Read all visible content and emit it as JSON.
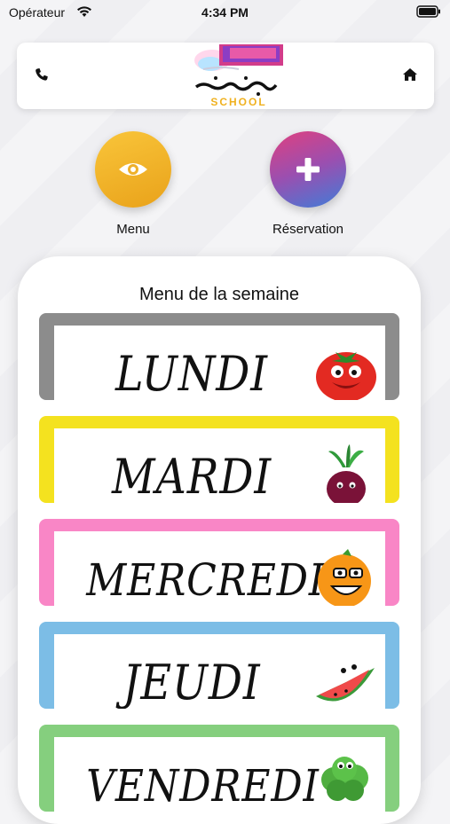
{
  "status_bar": {
    "carrier": "Opérateur",
    "time": "4:34 PM"
  },
  "header": {
    "logo_text": "SCHOOL",
    "phone_icon": "phone-icon",
    "home_icon": "home-icon"
  },
  "actions": {
    "menu_label": "Menu",
    "reservation_label": "Réservation"
  },
  "main": {
    "title": "Menu de la semaine",
    "days": [
      {
        "label": "LUNDI",
        "color": "#8c8c8c",
        "icon": "tomato-icon"
      },
      {
        "label": "MARDI",
        "color": "#f4e21f",
        "icon": "beet-icon"
      },
      {
        "label": "MERCREDI",
        "color": "#f986c6",
        "icon": "orange-icon"
      },
      {
        "label": "JEUDI",
        "color": "#7cbde6",
        "icon": "watermelon-icon"
      },
      {
        "label": "VENDREDI",
        "color": "#85cf7e",
        "icon": "broccoli-icon"
      }
    ]
  }
}
